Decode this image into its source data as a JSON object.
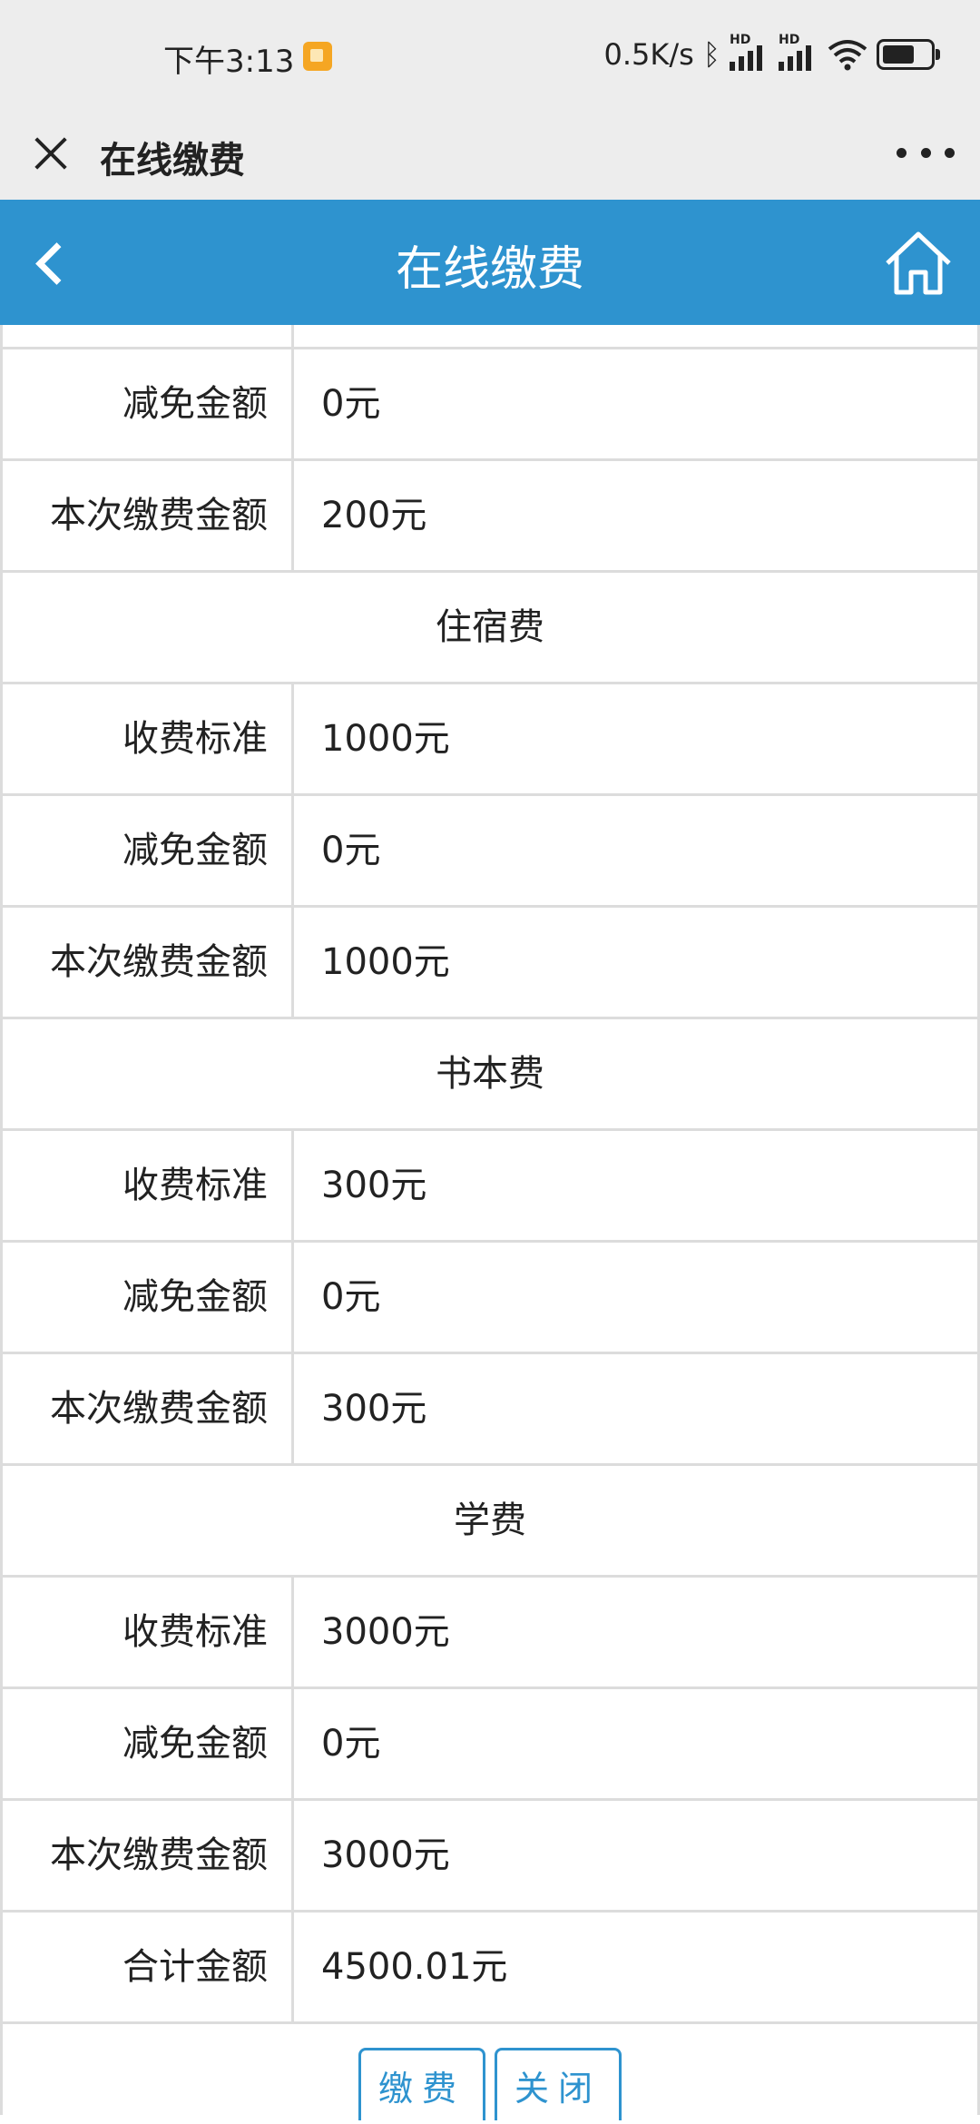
{
  "status_bar": {
    "time": "下午3:13",
    "network_speed": "0.5K/s",
    "bluetooth_icon": "ᛒ",
    "hd_label": "HD"
  },
  "title_bar": {
    "title": "在线缴费",
    "close_icon": "close-icon",
    "more_icon": "more-icon"
  },
  "app_bar": {
    "title": "在线缴费",
    "back_icon": "back-icon",
    "home_icon": "home-icon",
    "color": "#2e93cf"
  },
  "rows": [
    {
      "label": "减免金额",
      "value": "0元"
    },
    {
      "label": "本次缴费金额",
      "value": "200元"
    }
  ],
  "sections": [
    {
      "title": "住宿费",
      "rows": [
        {
          "label": "收费标准",
          "value": "1000元"
        },
        {
          "label": "减免金额",
          "value": "0元"
        },
        {
          "label": "本次缴费金额",
          "value": "1000元"
        }
      ]
    },
    {
      "title": "书本费",
      "rows": [
        {
          "label": "收费标准",
          "value": "300元"
        },
        {
          "label": "减免金额",
          "value": "0元"
        },
        {
          "label": "本次缴费金额",
          "value": "300元"
        }
      ]
    },
    {
      "title": "学费",
      "rows": [
        {
          "label": "收费标准",
          "value": "3000元"
        },
        {
          "label": "减免金额",
          "value": "0元"
        },
        {
          "label": "本次缴费金额",
          "value": "3000元"
        }
      ]
    }
  ],
  "total": {
    "label": "合计金额",
    "value": "4500.01元"
  },
  "buttons": {
    "pay": "缴费",
    "close": "关闭"
  }
}
